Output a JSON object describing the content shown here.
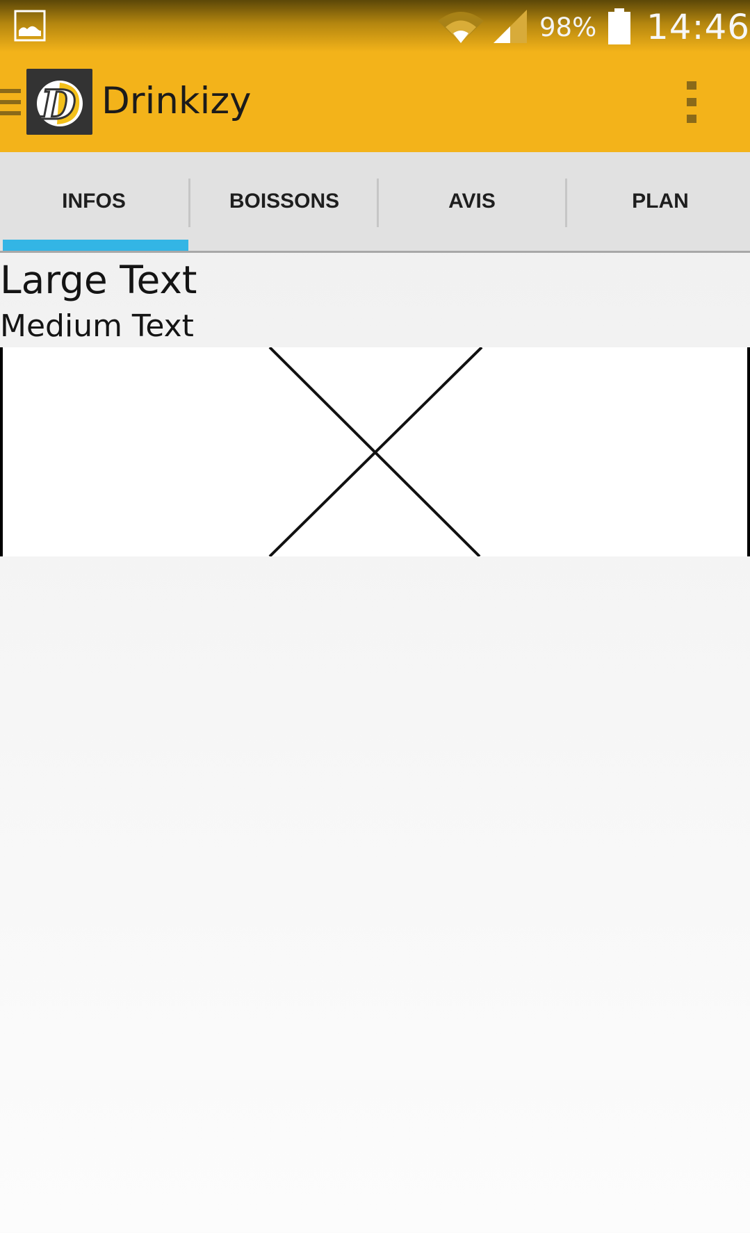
{
  "status_bar": {
    "battery_percent": "98%",
    "time": "14:46",
    "icons": [
      "gallery-notification-icon",
      "wifi-icon",
      "cell-signal-icon",
      "battery-icon"
    ]
  },
  "app_bar": {
    "title": "Drinkizy",
    "logo_letter": "D",
    "icons": [
      "drawer-icon",
      "overflow-menu-icon"
    ]
  },
  "tabs": [
    {
      "label": "INFOS",
      "selected": true
    },
    {
      "label": "BOISSONS",
      "selected": false
    },
    {
      "label": "AVIS",
      "selected": false
    },
    {
      "label": "PLAN",
      "selected": false
    }
  ],
  "content": {
    "large_text": "Large Text",
    "medium_text": "Medium Text",
    "image_placeholder_icon": "broken-image-x-icon"
  },
  "colors": {
    "app_bar": "#f3b31a",
    "tab_indicator": "#33b5e5",
    "tab_bar": "#e1e1e1"
  }
}
